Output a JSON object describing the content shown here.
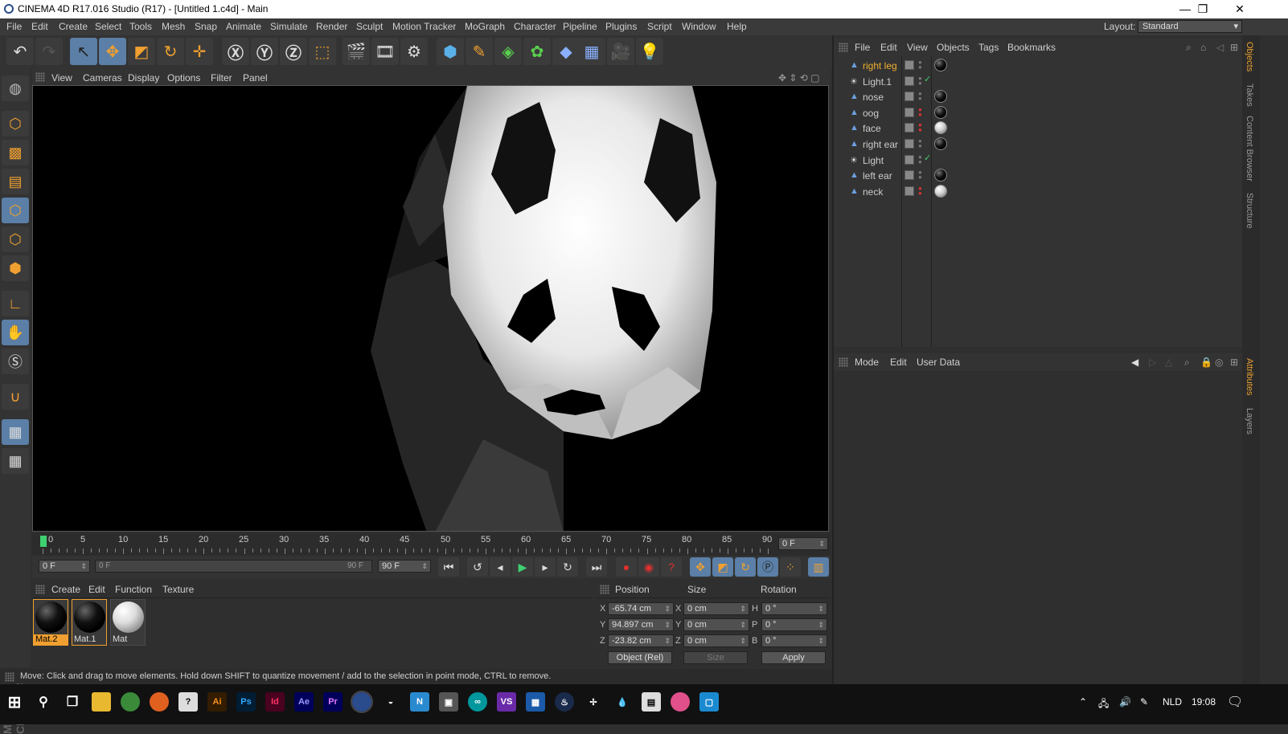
{
  "window": {
    "title": "CINEMA 4D R17.016 Studio (R17) - [Untitled 1.c4d] - Main",
    "min": "—",
    "max": "❐",
    "close": "✕"
  },
  "menu": [
    "File",
    "Edit",
    "Create",
    "Select",
    "Tools",
    "Mesh",
    "Snap",
    "Animate",
    "Simulate",
    "Render",
    "Sculpt",
    "Motion Tracker",
    "MoGraph",
    "Character",
    "Pipeline",
    "Plugins",
    "Script",
    "Window",
    "Help"
  ],
  "layout": {
    "label": "Layout:",
    "value": "Standard"
  },
  "viewport_menu": [
    "View",
    "Cameras",
    "Display",
    "Options",
    "Filter",
    "Panel"
  ],
  "timeline": {
    "ticks": [
      "0",
      "5",
      "10",
      "15",
      "20",
      "25",
      "30",
      "35",
      "40",
      "45",
      "50",
      "55",
      "60",
      "65",
      "70",
      "75",
      "80",
      "85",
      "90"
    ],
    "current": "0 F"
  },
  "transport": {
    "start": "0 F",
    "range_start": "0 F",
    "range_end": "90 F",
    "end": "90 F"
  },
  "material_menu": [
    "Create",
    "Edit",
    "Function",
    "Texture"
  ],
  "materials": [
    {
      "name": "Mat.2",
      "color": "#000000"
    },
    {
      "name": "Mat.1",
      "color": "#000000"
    },
    {
      "name": "Mat",
      "color": "#ffffff"
    }
  ],
  "coords": {
    "headers": [
      "Position",
      "Size",
      "Rotation"
    ],
    "rows": [
      {
        "axis": "X",
        "pos": "-65.74 cm",
        "size_axis": "X",
        "size": "0 cm",
        "rot_axis": "H",
        "rot": "0 °"
      },
      {
        "axis": "Y",
        "pos": "94.897 cm",
        "size_axis": "Y",
        "size": "0 cm",
        "rot_axis": "P",
        "rot": "0 °"
      },
      {
        "axis": "Z",
        "pos": "-23.82 cm",
        "size_axis": "Z",
        "size": "0 cm",
        "rot_axis": "B",
        "rot": "0 °"
      }
    ],
    "mode": "Object (Rel)",
    "size_mode": "Size",
    "apply": "Apply"
  },
  "status": "Move: Click and drag to move elements. Hold down SHIFT to quantize movement / add to the selection in point mode, CTRL to remove.",
  "objects_menu": [
    "File",
    "Edit",
    "View",
    "Objects",
    "Tags",
    "Bookmarks"
  ],
  "objects": [
    {
      "name": "right leg",
      "type": "mesh",
      "selected": true,
      "tag": "black"
    },
    {
      "name": "Light.1",
      "type": "light",
      "selected": false,
      "tag": "check"
    },
    {
      "name": "nose",
      "type": "mesh",
      "selected": false,
      "tag": "black"
    },
    {
      "name": "oog",
      "type": "mesh",
      "selected": false,
      "tag": "black"
    },
    {
      "name": "face",
      "type": "mesh",
      "selected": false,
      "tag": "white"
    },
    {
      "name": "right ear",
      "type": "mesh",
      "selected": false,
      "tag": "black"
    },
    {
      "name": "Light",
      "type": "light",
      "selected": false,
      "tag": "check"
    },
    {
      "name": "left ear",
      "type": "mesh",
      "selected": false,
      "tag": "black"
    },
    {
      "name": "neck",
      "type": "mesh",
      "selected": false,
      "tag": "white"
    }
  ],
  "attr_menu": [
    "Mode",
    "Edit",
    "User Data"
  ],
  "side_tabs": [
    "Objects",
    "Takes",
    "Content Browser",
    "Structure",
    "Attributes",
    "Layers"
  ],
  "taskbar": {
    "lang": "NLD",
    "time": "19:08"
  },
  "colors": {
    "accent": "#5b7fa6",
    "selected_text": "#f0b030",
    "tool_icon": "#f0a030"
  }
}
